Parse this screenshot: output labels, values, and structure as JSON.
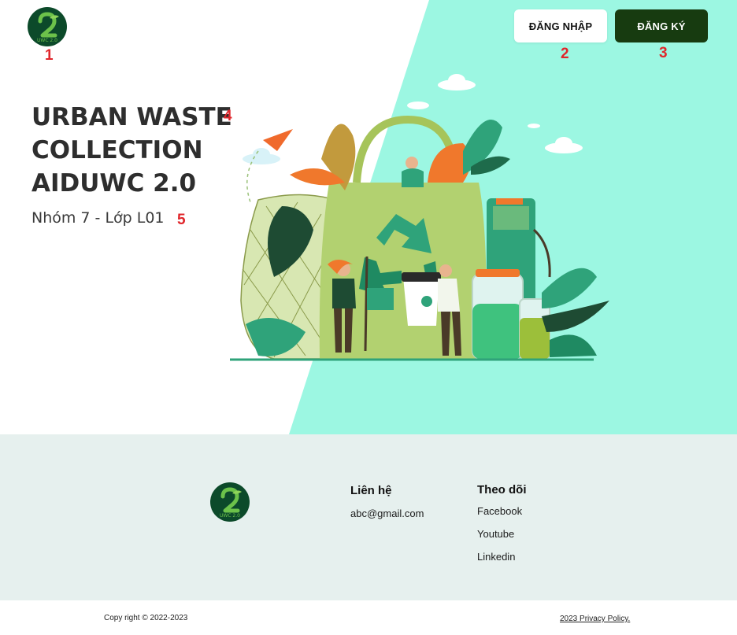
{
  "header": {
    "login_label": "ĐĂNG NHẬP",
    "signup_label": "ĐĂNG KÝ",
    "logo_text": "UWC 2.0"
  },
  "hero": {
    "title_lines": [
      "URBAN WASTE",
      "COLLECTION",
      "AIDUWC 2.0"
    ],
    "subtitle": "Nhóm 7 - Lớp L01"
  },
  "markers": [
    "1",
    "2",
    "3",
    "4",
    "5"
  ],
  "footer": {
    "logo_text": "UWC 2.0",
    "contact": {
      "title": "Liên hệ",
      "email": "abc@gmail.com"
    },
    "follow": {
      "title": "Theo dõi",
      "links": [
        "Facebook",
        "Youtube",
        "Linkedin"
      ]
    }
  },
  "bottom": {
    "copyright": "Copy right © 2022-2023",
    "privacy": "2023 Privacy Policy."
  },
  "colors": {
    "accent_mint": "#9cf7e2",
    "dark_green": "#173b10",
    "logo_green": "#0c4a2a",
    "footer_bg": "#e6f0ee",
    "marker_red": "#e0262b"
  },
  "icons": {
    "logo": "recycle-2-logo-icon",
    "illustration": "eco-shopping-bag-illustration"
  }
}
